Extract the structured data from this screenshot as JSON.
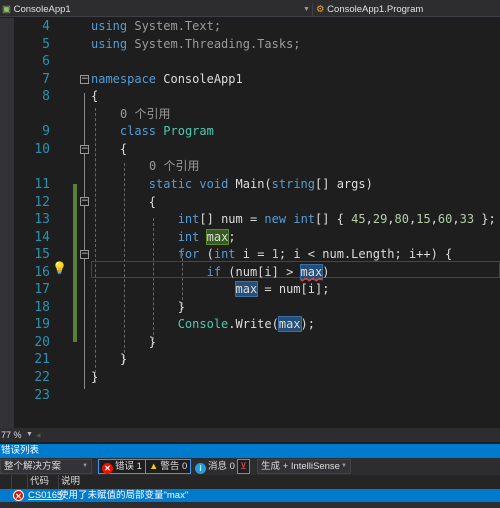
{
  "navbar": {
    "project": "ConsoleApp1",
    "class_scope": "ConsoleApp1.Program"
  },
  "editor": {
    "rows": [
      {
        "ln": "4",
        "tokens": [
          {
            "c": "kw",
            "t": "using"
          },
          {
            "c": "gr",
            "t": " System.Text;"
          }
        ]
      },
      {
        "ln": "5",
        "tokens": [
          {
            "c": "kw",
            "t": "using"
          },
          {
            "c": "gr",
            "t": " System.Threading.Tasks;"
          }
        ]
      },
      {
        "ln": "6",
        "tokens": []
      },
      {
        "ln": "7",
        "tokens": [
          {
            "c": "kw",
            "t": "namespace"
          },
          {
            "c": "pl",
            "t": " ConsoleApp1"
          }
        ]
      },
      {
        "ln": "8",
        "tokens": [
          {
            "c": "pl",
            "t": "{"
          }
        ]
      },
      {
        "lens": "0 个引用",
        "indent": "    "
      },
      {
        "ln": "9",
        "tokens": [
          {
            "c": "pl",
            "t": "    "
          },
          {
            "c": "kw",
            "t": "class"
          },
          {
            "c": "pl",
            "t": " "
          },
          {
            "c": "ty",
            "t": "Program"
          }
        ]
      },
      {
        "ln": "10",
        "tokens": [
          {
            "c": "pl",
            "t": "    {"
          }
        ]
      },
      {
        "lens": "0 个引用",
        "indent": "        "
      },
      {
        "ln": "11",
        "tokens": [
          {
            "c": "pl",
            "t": "        "
          },
          {
            "c": "kw",
            "t": "static"
          },
          {
            "c": "pl",
            "t": " "
          },
          {
            "c": "kw",
            "t": "void"
          },
          {
            "c": "pl",
            "t": " Main("
          },
          {
            "c": "kw",
            "t": "string"
          },
          {
            "c": "pl",
            "t": "[] args)"
          }
        ]
      },
      {
        "ln": "12",
        "tokens": [
          {
            "c": "pl",
            "t": "        {"
          }
        ]
      },
      {
        "ln": "13",
        "tokens": [
          {
            "c": "pl",
            "t": "            "
          },
          {
            "c": "kw",
            "t": "int"
          },
          {
            "c": "pl",
            "t": "[] num = "
          },
          {
            "c": "kw",
            "t": "new"
          },
          {
            "c": "pl",
            "t": " "
          },
          {
            "c": "kw",
            "t": "int"
          },
          {
            "c": "pl",
            "t": "[] { "
          },
          {
            "c": "num",
            "t": "45"
          },
          {
            "c": "pl",
            "t": ","
          },
          {
            "c": "num",
            "t": "29"
          },
          {
            "c": "pl",
            "t": ","
          },
          {
            "c": "num",
            "t": "80"
          },
          {
            "c": "pl",
            "t": ","
          },
          {
            "c": "num",
            "t": "15"
          },
          {
            "c": "pl",
            "t": ","
          },
          {
            "c": "num",
            "t": "60"
          },
          {
            "c": "pl",
            "t": ","
          },
          {
            "c": "num",
            "t": "33"
          },
          {
            "c": "pl",
            "t": " };"
          }
        ]
      },
      {
        "ln": "14",
        "tokens": [
          {
            "c": "pl",
            "t": "            "
          },
          {
            "c": "kw",
            "t": "int"
          },
          {
            "c": "pl",
            "t": " "
          },
          {
            "c": "pl hd",
            "t": "max"
          },
          {
            "c": "pl",
            "t": ";"
          }
        ]
      },
      {
        "ln": "15",
        "tokens": [
          {
            "c": "pl",
            "t": "            "
          },
          {
            "c": "kw",
            "t": "for"
          },
          {
            "c": "pl",
            "t": " ("
          },
          {
            "c": "kw",
            "t": "int"
          },
          {
            "c": "pl",
            "t": " i = "
          },
          {
            "c": "num",
            "t": "1"
          },
          {
            "c": "pl",
            "t": "; i < num.Length; i++) {"
          }
        ]
      },
      {
        "ln": "16",
        "tokens": [
          {
            "c": "pl",
            "t": "                "
          },
          {
            "c": "kw",
            "t": "if"
          },
          {
            "c": "pl",
            "t": " (num[i] > "
          },
          {
            "c": "pl hr sq",
            "t": "max"
          },
          {
            "c": "pl",
            "t": ")"
          }
        ]
      },
      {
        "ln": "17",
        "tokens": [
          {
            "c": "pl",
            "t": "                    "
          },
          {
            "c": "pl hr",
            "t": "max"
          },
          {
            "c": "pl",
            "t": " = num[i];"
          }
        ]
      },
      {
        "ln": "18",
        "tokens": [
          {
            "c": "pl",
            "t": "            }"
          }
        ]
      },
      {
        "ln": "19",
        "tokens": [
          {
            "c": "pl",
            "t": "            "
          },
          {
            "c": "ty",
            "t": "Console"
          },
          {
            "c": "pl",
            "t": ".Write("
          },
          {
            "c": "pl hr",
            "t": "max"
          },
          {
            "c": "pl",
            "t": ");"
          }
        ]
      },
      {
        "ln": "20",
        "tokens": [
          {
            "c": "pl",
            "t": "        }"
          }
        ]
      },
      {
        "ln": "21",
        "tokens": [
          {
            "c": "pl",
            "t": "    }"
          }
        ]
      },
      {
        "ln": "22",
        "tokens": [
          {
            "c": "pl",
            "t": "}"
          }
        ]
      },
      {
        "ln": "23",
        "tokens": []
      }
    ]
  },
  "zoom": {
    "value": "77 %"
  },
  "error_list": {
    "title": "错误列表",
    "scope": "整个解决方案",
    "errors_label": "错误 1",
    "warnings_label": "警告 0",
    "messages_label": "消息 0",
    "build_filter": "生成 + IntelliSense",
    "columns": {
      "code": "代码",
      "description": "说明"
    },
    "rows": [
      {
        "code": "CS0165",
        "description": "使用了未赋值的局部变量\"max\""
      }
    ]
  },
  "colors": {
    "accent": "#007acc",
    "error": "#e51400",
    "warning": "#f5c518",
    "info": "#1ba1e2"
  }
}
